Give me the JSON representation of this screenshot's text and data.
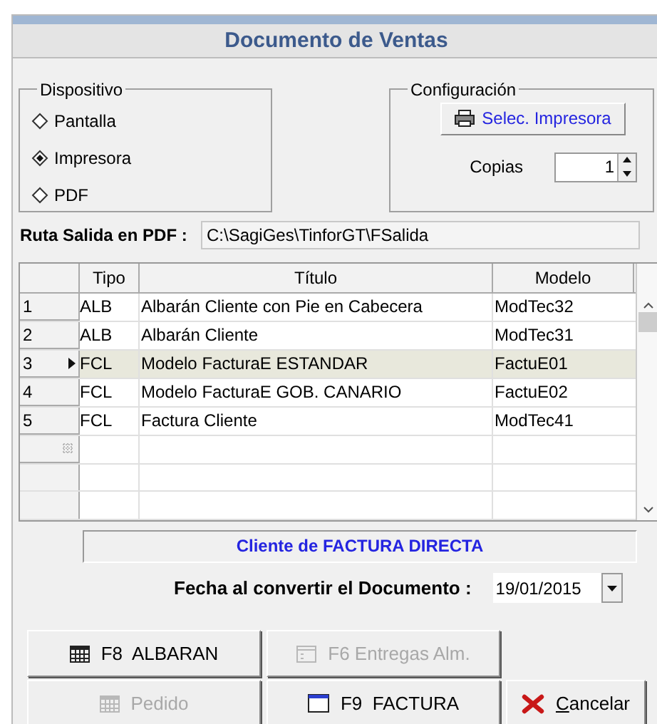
{
  "window": {
    "title": "Documento de Ventas"
  },
  "dispositivo": {
    "label": "Dispositivo",
    "options": [
      {
        "label": "Pantalla",
        "selected": false
      },
      {
        "label": "Impresora",
        "selected": true
      },
      {
        "label": "PDF",
        "selected": false
      }
    ]
  },
  "configuracion": {
    "label": "Configuración",
    "printer_button": "Selec. Impresora",
    "copies_label": "Copias",
    "copies_value": "1"
  },
  "pdf_path": {
    "label": "Ruta Salida en PDF :",
    "value": "C:\\SagiGes\\TinforGT\\FSalida"
  },
  "table": {
    "columns": [
      "Tipo",
      "Título",
      "Modelo"
    ],
    "rows": [
      {
        "number": "1",
        "tipo": "ALB",
        "titulo": "Albarán Cliente con Pie en Cabecera",
        "modelo": "ModTec32",
        "selected": false
      },
      {
        "number": "2",
        "tipo": "ALB",
        "titulo": "Albarán Cliente",
        "modelo": "ModTec31",
        "selected": false
      },
      {
        "number": "3",
        "tipo": "FCL",
        "titulo": "Modelo FacturaE ESTANDAR",
        "modelo": "FactuE01",
        "selected": true
      },
      {
        "number": "4",
        "tipo": "FCL",
        "titulo": "Modelo FacturaE GOB. CANARIO",
        "modelo": "FactuE02",
        "selected": false
      },
      {
        "number": "5",
        "tipo": "FCL",
        "titulo": "Factura Cliente",
        "modelo": "ModTec41",
        "selected": false
      }
    ]
  },
  "client_banner": "Cliente de FACTURA DIRECTA",
  "date": {
    "label": "Fecha al convertir el Documento :",
    "value": "19/01/2015"
  },
  "buttons": [
    {
      "label": "F8  ALBARAN",
      "kind": "grid",
      "disabled": false
    },
    {
      "label": "F6 Entregas Alm.",
      "kind": "list",
      "disabled": true
    },
    {
      "label": "Pedido",
      "kind": "grid",
      "disabled": true
    },
    {
      "label": "F9  FACTURA",
      "kind": "window",
      "disabled": false
    },
    {
      "label": "Cancelar",
      "kind": "cancel",
      "disabled": false,
      "underlined_first": true
    }
  ]
}
